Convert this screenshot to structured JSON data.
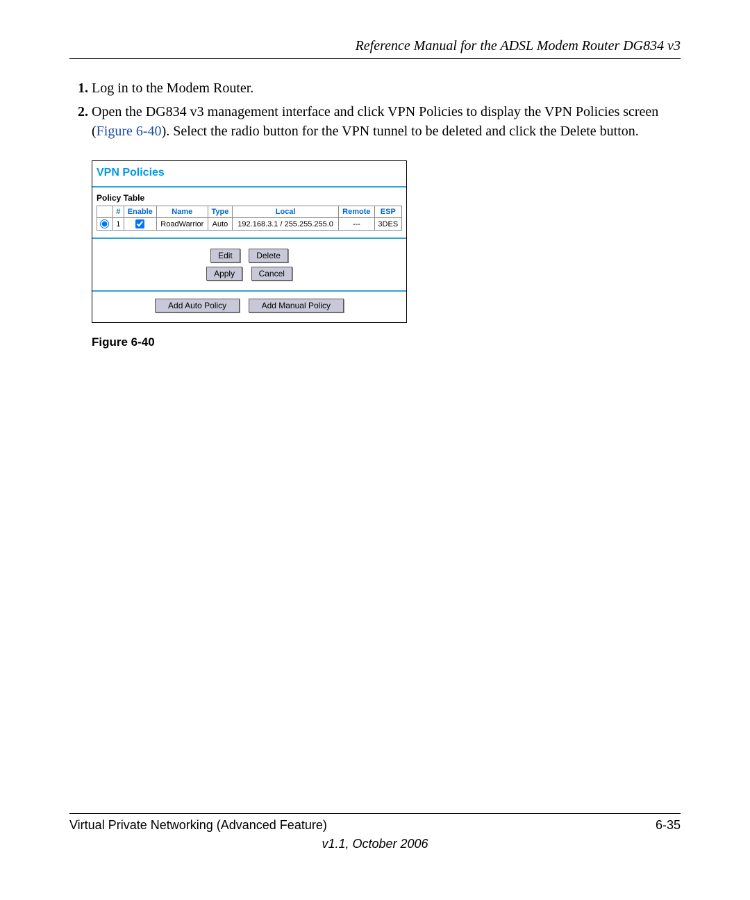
{
  "header": {
    "title": "Reference Manual for the ADSL Modem Router DG834 v3"
  },
  "steps": {
    "item1": "Log in to the Modem Router.",
    "item2_a": "Open the DG834 v3 management interface and click VPN Policies to display the VPN Policies screen (",
    "item2_figref": "Figure 6-40",
    "item2_b": "). Select the radio button for the VPN tunnel to be deleted and click the Delete button."
  },
  "screenshot": {
    "title": "VPN Policies",
    "table_label": "Policy Table",
    "headers": {
      "num": "#",
      "enable": "Enable",
      "name": "Name",
      "type": "Type",
      "local": "Local",
      "remote": "Remote",
      "esp": "ESP"
    },
    "row": {
      "num": "1",
      "name": "RoadWarrior",
      "type": "Auto",
      "local": "192.168.3.1 / 255.255.255.0",
      "remote": "---",
      "esp": "3DES"
    },
    "buttons": {
      "edit": "Edit",
      "delete": "Delete",
      "apply": "Apply",
      "cancel": "Cancel",
      "add_auto": "Add Auto Policy",
      "add_manual": "Add Manual Policy"
    }
  },
  "caption": "Figure 6-40",
  "footer": {
    "section": "Virtual Private Networking (Advanced Feature)",
    "page": "6-35",
    "version": "v1.1, October 2006"
  }
}
